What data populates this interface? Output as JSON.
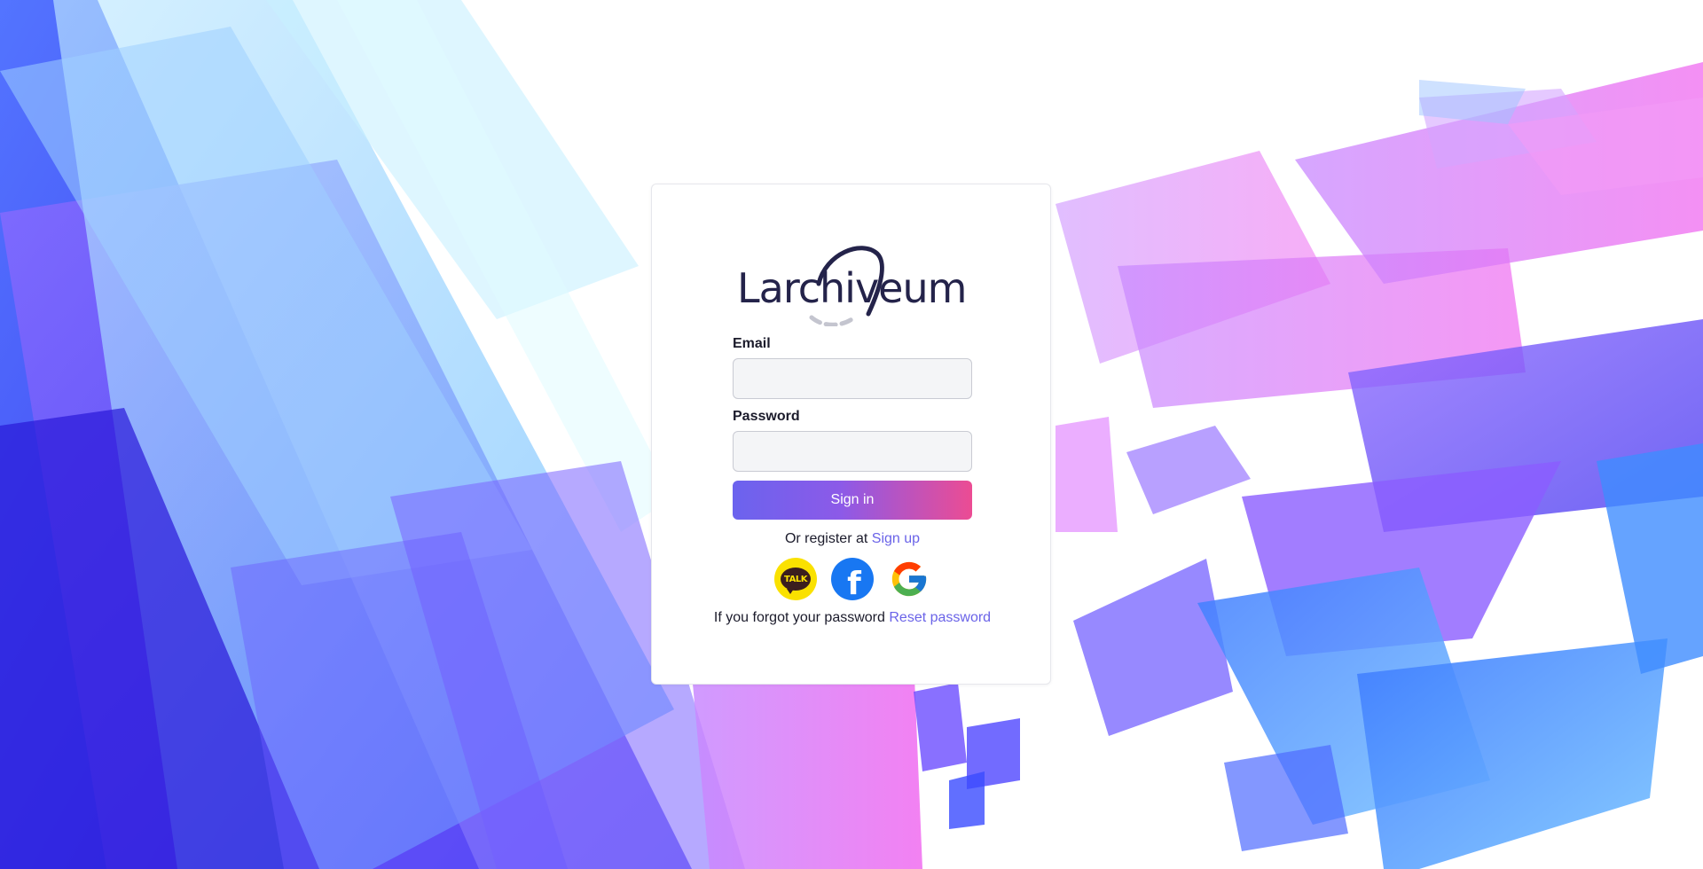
{
  "brand": {
    "name": "Larchiveum"
  },
  "login": {
    "email_label": "Email",
    "email_value": "",
    "password_label": "Password",
    "password_value": "",
    "signin_label": "Sign in",
    "register_prefix": "Or register at",
    "register_link": "Sign up",
    "forgot_prefix": "If you forgot your password",
    "forgot_link": "Reset password"
  },
  "social": {
    "kakao_text": "TALK",
    "facebook_glyph": "f",
    "kakao_icon": "kakaotalk-icon",
    "facebook_icon": "facebook-icon",
    "google_icon": "google-icon"
  },
  "colors": {
    "brand_text": "#24234a",
    "link": "#6a63e8",
    "button_gradient_start": "#6b63ee",
    "button_gradient_end": "#ec4c93",
    "kakao_yellow": "#fae100",
    "facebook_blue": "#1877f2"
  }
}
